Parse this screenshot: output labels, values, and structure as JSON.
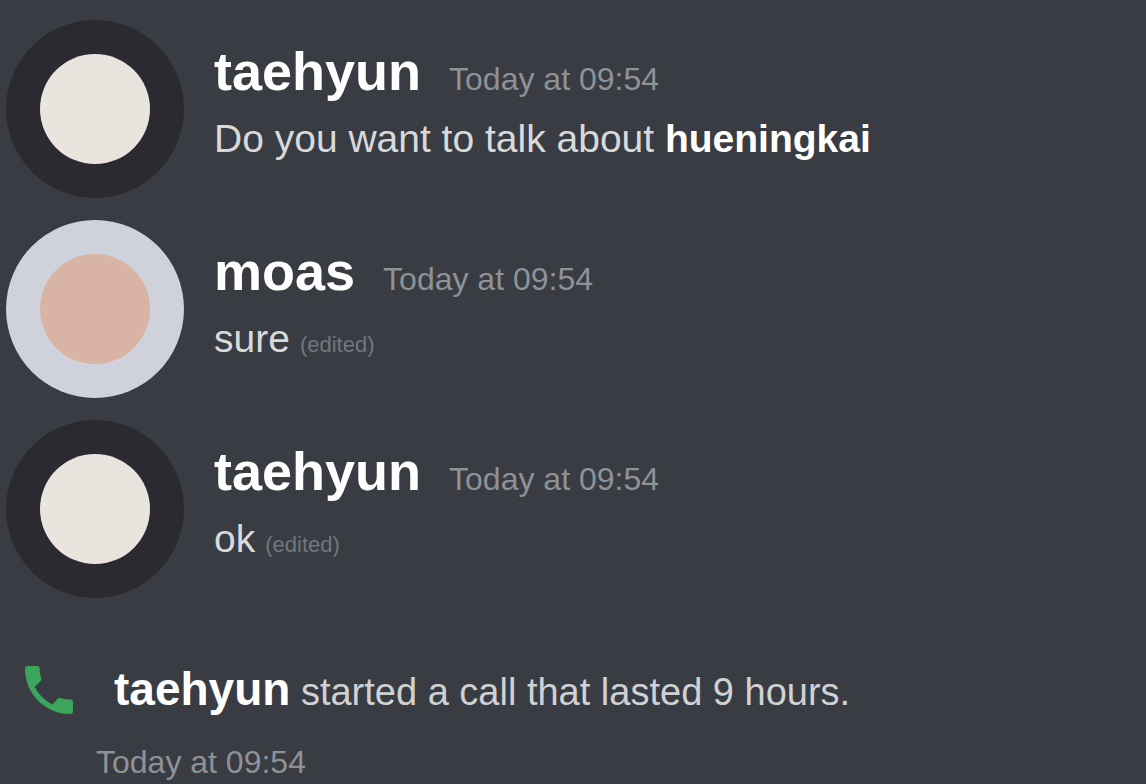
{
  "messages": [
    {
      "author": "taehyun",
      "time": "Today at 09:54",
      "avatar": "taehyun",
      "segments": [
        {
          "text": "Do you want to talk about ",
          "bold": false
        },
        {
          "text": "hueningkai",
          "bold": true
        }
      ],
      "edited": ""
    },
    {
      "author": "moas",
      "time": "Today at 09:54",
      "avatar": "moas",
      "segments": [
        {
          "text": "sure",
          "bold": false
        }
      ],
      "edited": "(edited)"
    },
    {
      "author": "taehyun",
      "time": "Today at 09:54",
      "avatar": "taehyun",
      "segments": [
        {
          "text": "ok",
          "bold": false
        }
      ],
      "edited": "(edited)"
    }
  ],
  "call": {
    "author": "taehyun",
    "text": " started a call that lasted 9 hours.",
    "time": "Today at 09:54"
  }
}
